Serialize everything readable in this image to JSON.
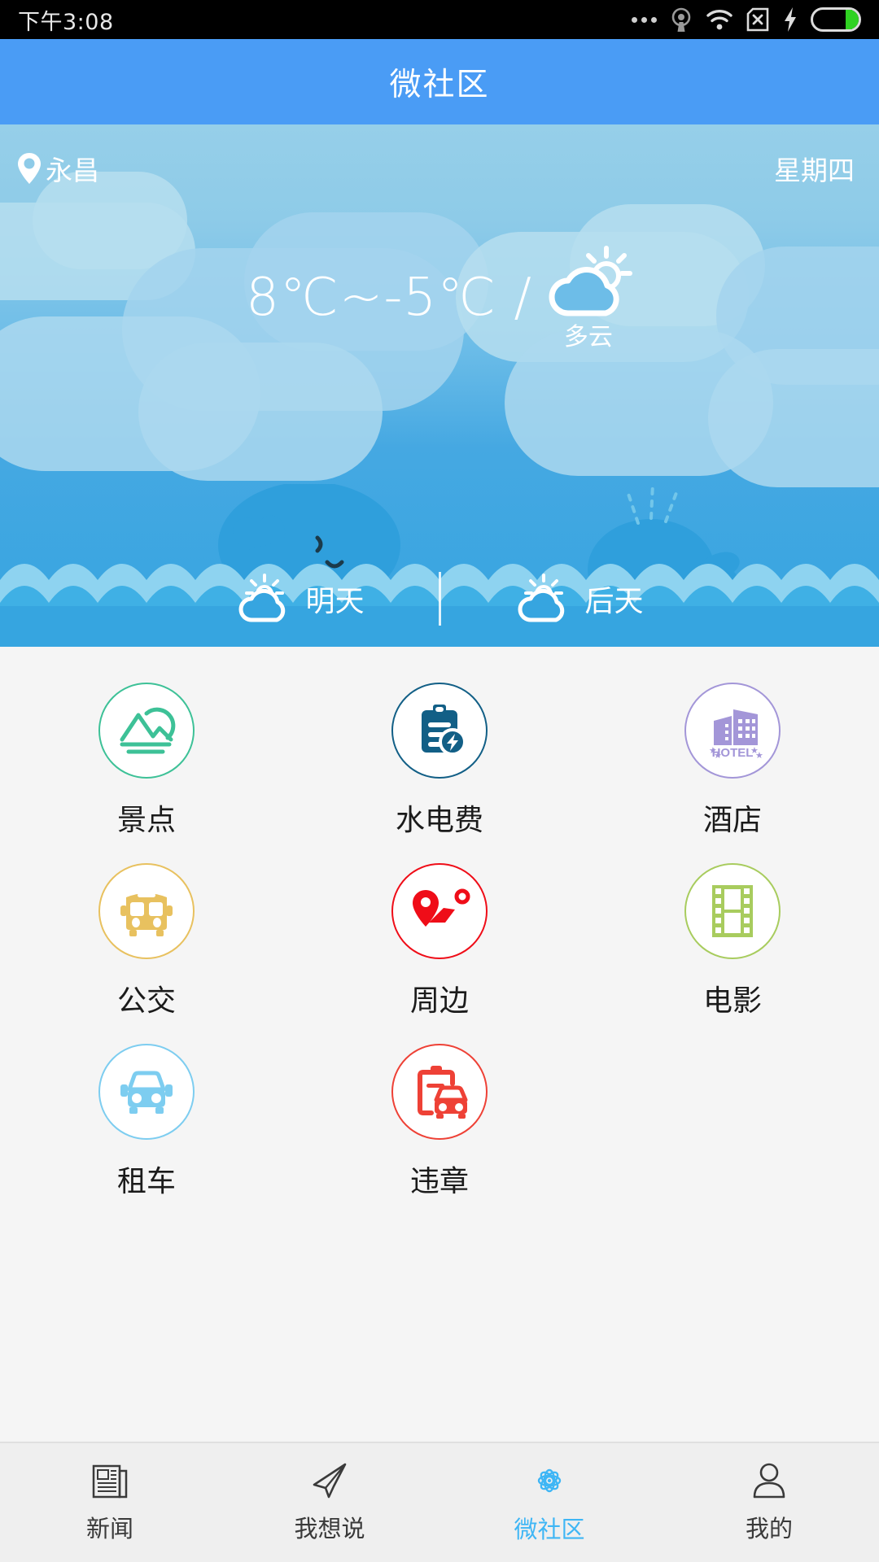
{
  "statusbar": {
    "time": "下午3:08",
    "icons": [
      "more-dots-icon",
      "hotspot-icon",
      "wifi-icon",
      "sim-no-signal-icon",
      "charging-bolt-icon",
      "battery-icon"
    ]
  },
  "titlebar": {
    "title": "微社区"
  },
  "weather": {
    "location": "永昌",
    "location_icon": "location-pin-icon",
    "weekday": "星期四",
    "temperature": "8℃~-5℃ /",
    "condition": "多云",
    "condition_icon": "sun-behind-cloud-icon",
    "forecast": [
      {
        "label": "明天",
        "icon": "sun-behind-cloud-icon"
      },
      {
        "label": "后天",
        "icon": "sun-behind-cloud-icon"
      }
    ]
  },
  "grid": {
    "items": [
      {
        "label": "景点",
        "icon": "mountain-landscape-icon",
        "color": "#3dc197"
      },
      {
        "label": "水电费",
        "icon": "clipboard-bolt-icon",
        "color": "#125f86"
      },
      {
        "label": "酒店",
        "icon": "hotel-building-icon",
        "color": "#a396d8"
      },
      {
        "label": "公交",
        "icon": "bus-icon",
        "color": "#e8c15f"
      },
      {
        "label": "周边",
        "icon": "map-route-pin-icon",
        "color": "#ef0d18"
      },
      {
        "label": "电影",
        "icon": "film-strip-icon",
        "color": "#a8cc5e"
      },
      {
        "label": "租车",
        "icon": "car-icon",
        "color": "#7dcdf0"
      },
      {
        "label": "违章",
        "icon": "clipboard-car-icon",
        "color": "#ee4136"
      }
    ]
  },
  "tabbar": {
    "active_color": "#3fb6f5",
    "items": [
      {
        "label": "新闻",
        "icon": "newspaper-icon",
        "active": false
      },
      {
        "label": "我想说",
        "icon": "paper-plane-icon",
        "active": false
      },
      {
        "label": "微社区",
        "icon": "flower-icon",
        "active": true
      },
      {
        "label": "我的",
        "icon": "person-icon",
        "active": false
      }
    ]
  }
}
